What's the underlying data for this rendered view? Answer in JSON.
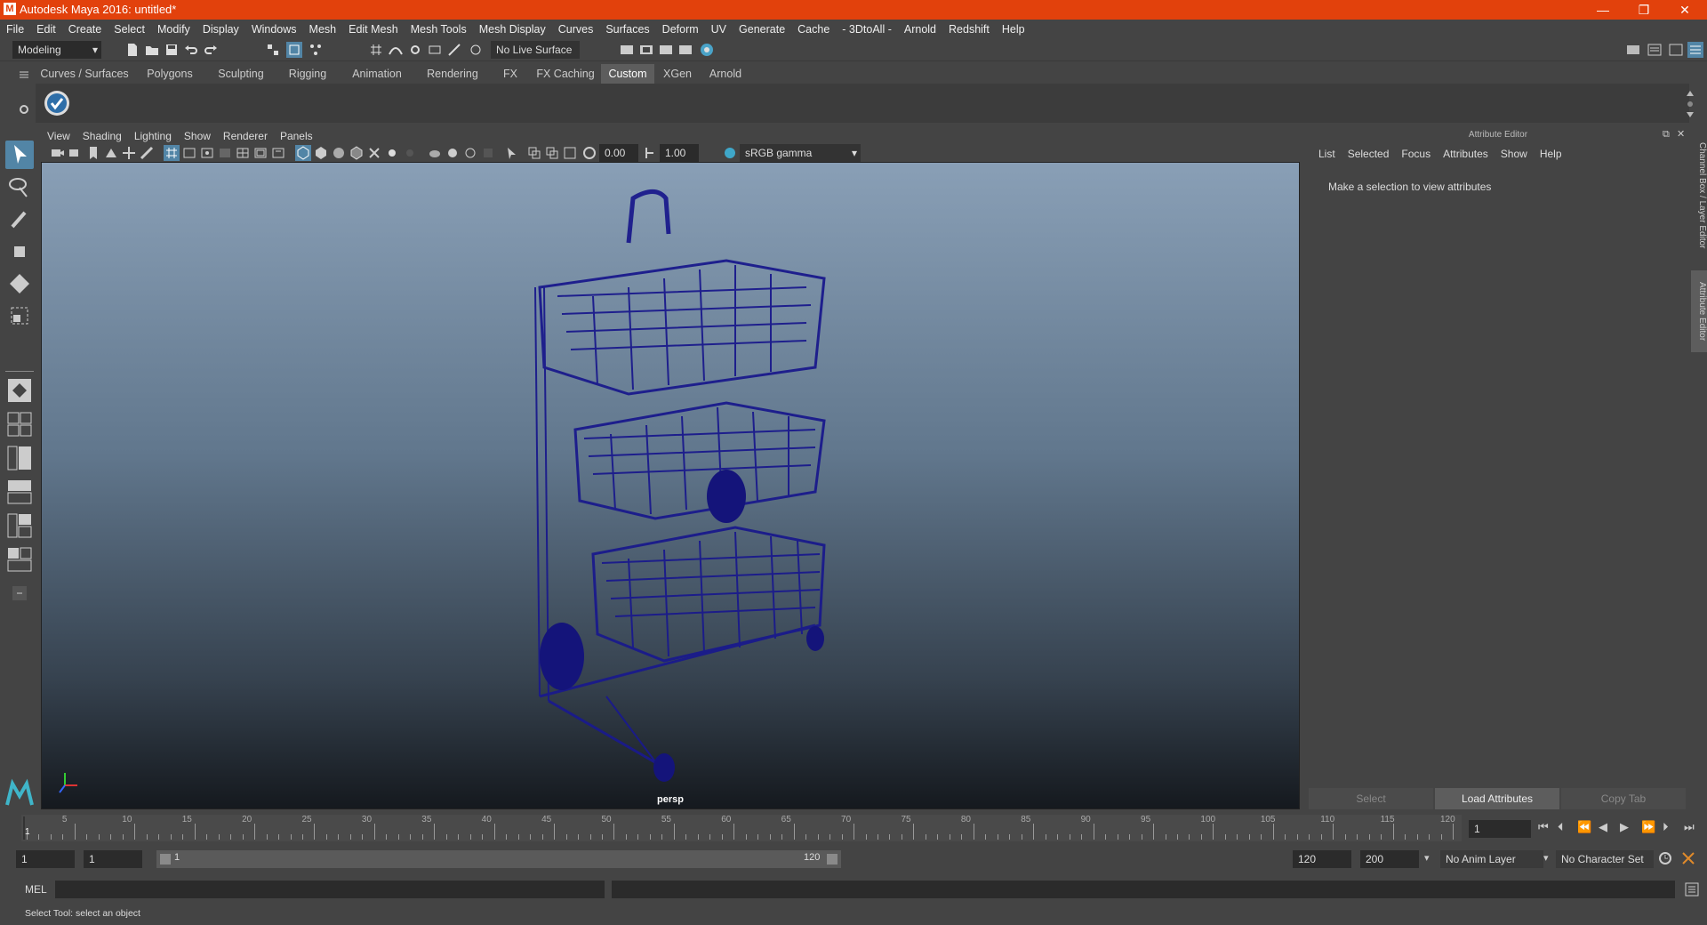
{
  "titlebar": {
    "title": "Autodesk Maya 2016: untitled*",
    "minimize": "—",
    "maximize": "❐",
    "close": "✕"
  },
  "menubar": [
    "File",
    "Edit",
    "Create",
    "Select",
    "Modify",
    "Display",
    "Windows",
    "Mesh",
    "Edit Mesh",
    "Mesh Tools",
    "Mesh Display",
    "Curves",
    "Surfaces",
    "Deform",
    "UV",
    "Generate",
    "Cache",
    "- 3DtoAll -",
    "Arnold",
    "Redshift",
    "Help"
  ],
  "statusline": {
    "menuset": "Modeling",
    "live_surface": "No Live Surface"
  },
  "shelf_tabs": [
    "Curves / Surfaces",
    "Polygons",
    "Sculpting",
    "Rigging",
    "Animation",
    "Rendering",
    "FX",
    "FX Caching",
    "Custom",
    "XGen",
    "Arnold"
  ],
  "active_shelf": "Custom",
  "panel_menu": [
    "View",
    "Shading",
    "Lighting",
    "Show",
    "Renderer",
    "Panels"
  ],
  "panel_toolbar": {
    "exposure": "0.00",
    "gamma": "1.00",
    "color_space": "sRGB gamma"
  },
  "viewport": {
    "camera": "persp"
  },
  "attribute_editor": {
    "title": "Attribute Editor",
    "menu": [
      "List",
      "Selected",
      "Focus",
      "Attributes",
      "Show",
      "Help"
    ],
    "message": "Make a selection to view attributes",
    "buttons": {
      "select": "Select",
      "load": "Load Attributes",
      "copy": "Copy Tab"
    }
  },
  "side_tabs": {
    "channel_box": "Channel Box / Layer Editor",
    "attribute_editor": "Attribute Editor"
  },
  "timeline": {
    "ticks": [
      "5",
      "10",
      "15",
      "20",
      "25",
      "30",
      "35",
      "40",
      "45",
      "50",
      "55",
      "60",
      "65",
      "70",
      "75",
      "80",
      "85",
      "90",
      "95",
      "100",
      "105",
      "110",
      "115",
      "120"
    ],
    "start_marker": "1",
    "current_frame": "1"
  },
  "range": {
    "start": "1",
    "anim_start": "1",
    "slider_start": "1",
    "slider_end": "120",
    "end": "120",
    "anim_end": "200",
    "anim_layer": "No Anim Layer",
    "character_set": "No Character Set"
  },
  "command_line": {
    "label": "MEL"
  },
  "help_line": {
    "text": "Select Tool: select an object"
  },
  "colors": {
    "title_bar": "#e2410c",
    "active_tab": "#5d5d5d",
    "wireframe": "#1a1a8c",
    "highlight": "#5285a6"
  }
}
